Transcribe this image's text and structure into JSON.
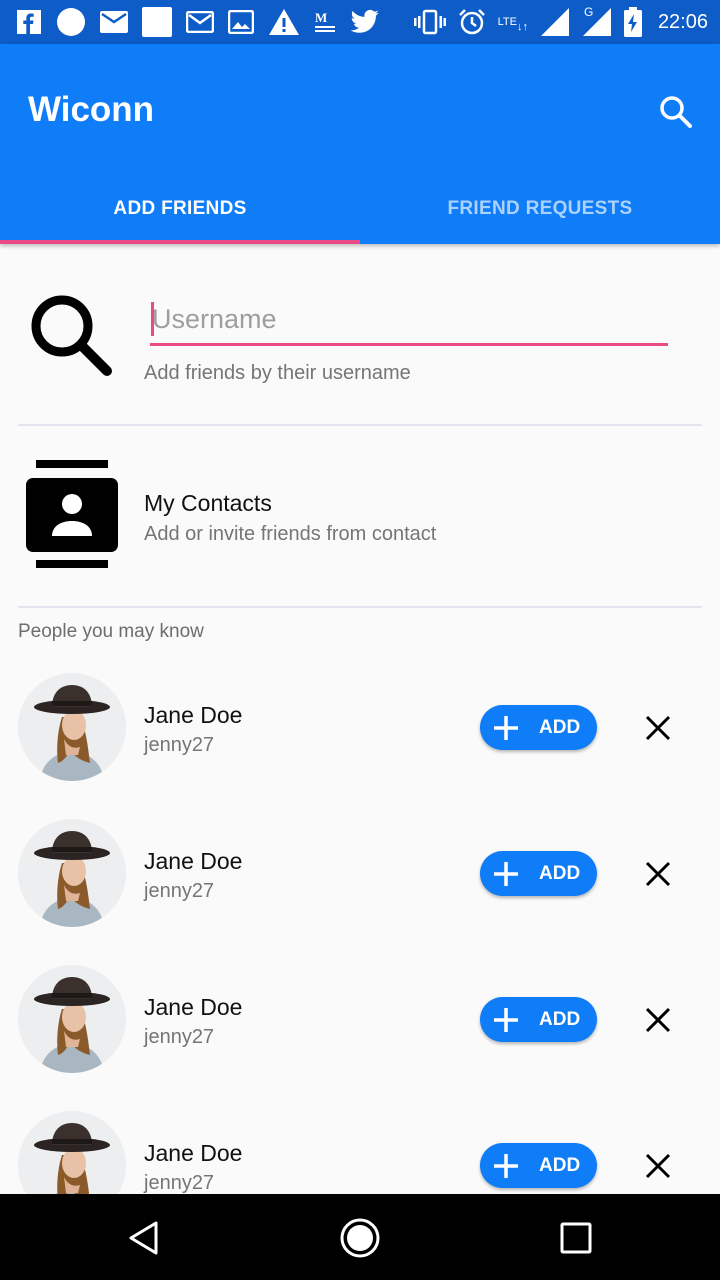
{
  "status_bar": {
    "time": "22:06",
    "network": "LTE",
    "signal2": "G",
    "left_icons": [
      "facebook-icon",
      "circle-icon",
      "mail-icon",
      "blank-icon",
      "gmail-icon",
      "image-icon",
      "warning-icon",
      "medium-icon",
      "twitter-icon"
    ],
    "right_icons": [
      "vibrate-icon",
      "alarm-icon",
      "signal-icon",
      "battery-charging-icon"
    ]
  },
  "app": {
    "title": "Wiconn",
    "search_icon": "search-icon",
    "primary_color": "#0f7cf8",
    "accent_color": "#e94b86"
  },
  "tabs": [
    {
      "label": "ADD FRIENDS",
      "active": true
    },
    {
      "label": "FRIEND REQUESTS",
      "active": false
    }
  ],
  "search": {
    "placeholder": "Username",
    "value": "",
    "hint": "Add friends by their username"
  },
  "contacts": {
    "title": "My Contacts",
    "subtitle": "Add or invite friends from contact"
  },
  "people": {
    "section_label": "People you may know",
    "add_label": "ADD",
    "items": [
      {
        "name": "Jane Doe",
        "username": "jenny27"
      },
      {
        "name": "Jane Doe",
        "username": "jenny27"
      },
      {
        "name": "Jane Doe",
        "username": "jenny27"
      },
      {
        "name": "Jane Doe",
        "username": "jenny27"
      }
    ]
  },
  "nav": {
    "icons": [
      "back-icon",
      "home-icon",
      "recents-icon"
    ]
  }
}
